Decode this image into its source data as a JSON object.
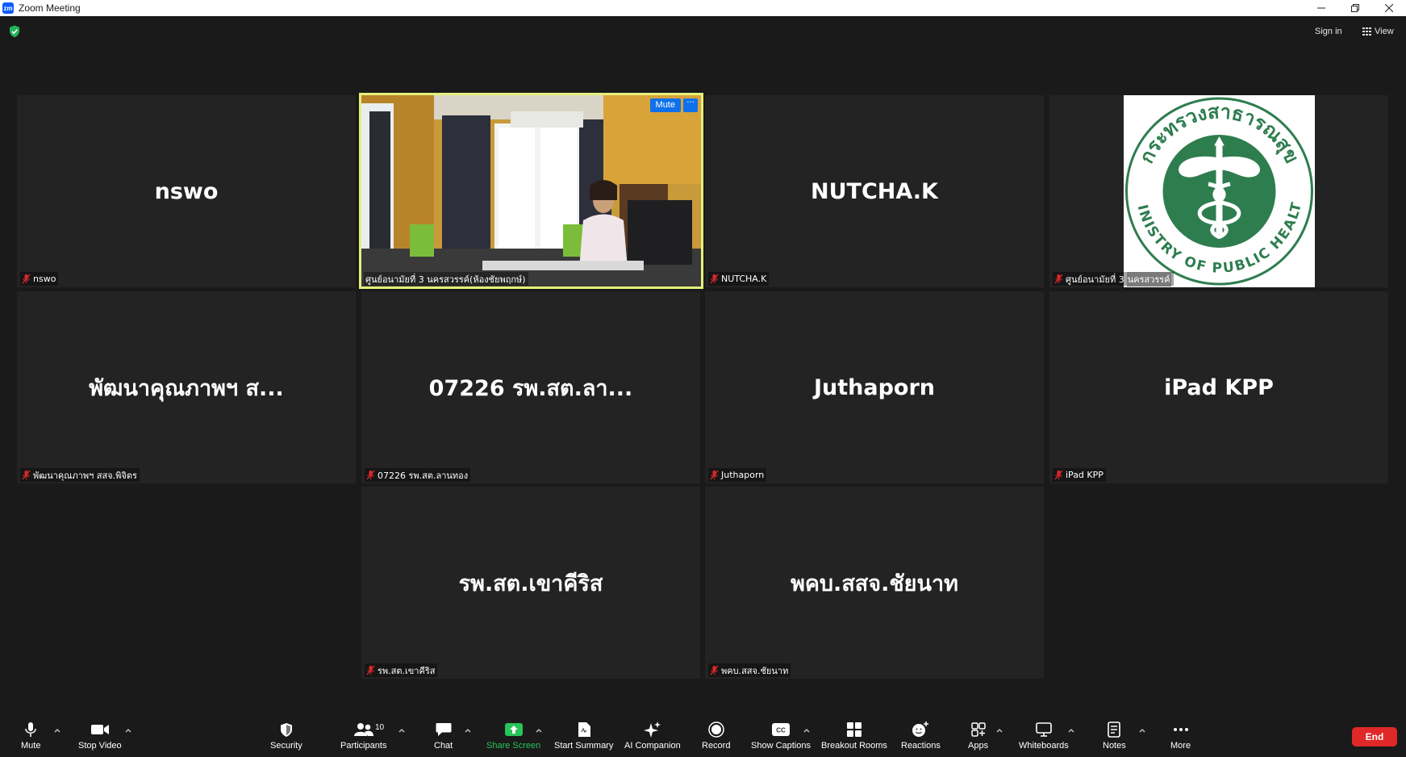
{
  "window": {
    "logo_text": "zm",
    "title": "Zoom Meeting"
  },
  "header": {
    "sign_in": "Sign in",
    "view": "View"
  },
  "tiles": [
    {
      "display": "nswo",
      "name": "nswo"
    },
    {
      "display": "",
      "name": "ศูนย์อนามัยที่ 3 นครสวรรค์(ห้องชัยพฤกษ์)",
      "mute_label": "Mute",
      "more_label": "···"
    },
    {
      "display": "NUTCHA.K",
      "name": "NUTCHA.K"
    },
    {
      "display": "",
      "name_a": "ศูนย์อนามัยที่ 3",
      "name_b": "นครสวรรค์",
      "logo_text_top": "กระทรวงสาธารณสุข",
      "logo_text_bottom": "MINISTRY OF PUBLIC HEALTH"
    },
    {
      "display": "พัฒนาคุณภาพฯ ส...",
      "name": "พัฒนาคุณภาพฯ สสจ.พิจิตร"
    },
    {
      "display": "07226 รพ.สต.ลา...",
      "name": "07226 รพ.สต.ลานทอง"
    },
    {
      "display": "Juthaporn",
      "name": "Juthaporn"
    },
    {
      "display": "iPad KPP",
      "name": "iPad KPP"
    },
    {
      "display": "รพ.สต.เขาคีริส",
      "name": "รพ.สต.เขาคีริส"
    },
    {
      "display": "พคบ.สสจ.ชัยนาท",
      "name": "พคบ.สสจ.ชัยนาท"
    }
  ],
  "toolbar": {
    "mute": "Mute",
    "stop_video": "Stop Video",
    "security": "Security",
    "participants": "Participants",
    "participants_count": "10",
    "chat": "Chat",
    "share_screen": "Share Screen",
    "start_summary": "Start Summary",
    "ai_companion": "AI Companion",
    "record": "Record",
    "show_captions": "Show Captions",
    "breakout_rooms": "Breakout Rooms",
    "reactions": "Reactions",
    "apps": "Apps",
    "whiteboards": "Whiteboards",
    "notes": "Notes",
    "more": "More",
    "end": "End"
  },
  "colors": {
    "background": "#1a1a1a",
    "tile": "#232323",
    "active_speaker": "#e4f07a",
    "share_green": "#27c45a",
    "end_red": "#e02828",
    "accent_blue": "#0e71eb",
    "logo_green": "#2e7d4f"
  }
}
